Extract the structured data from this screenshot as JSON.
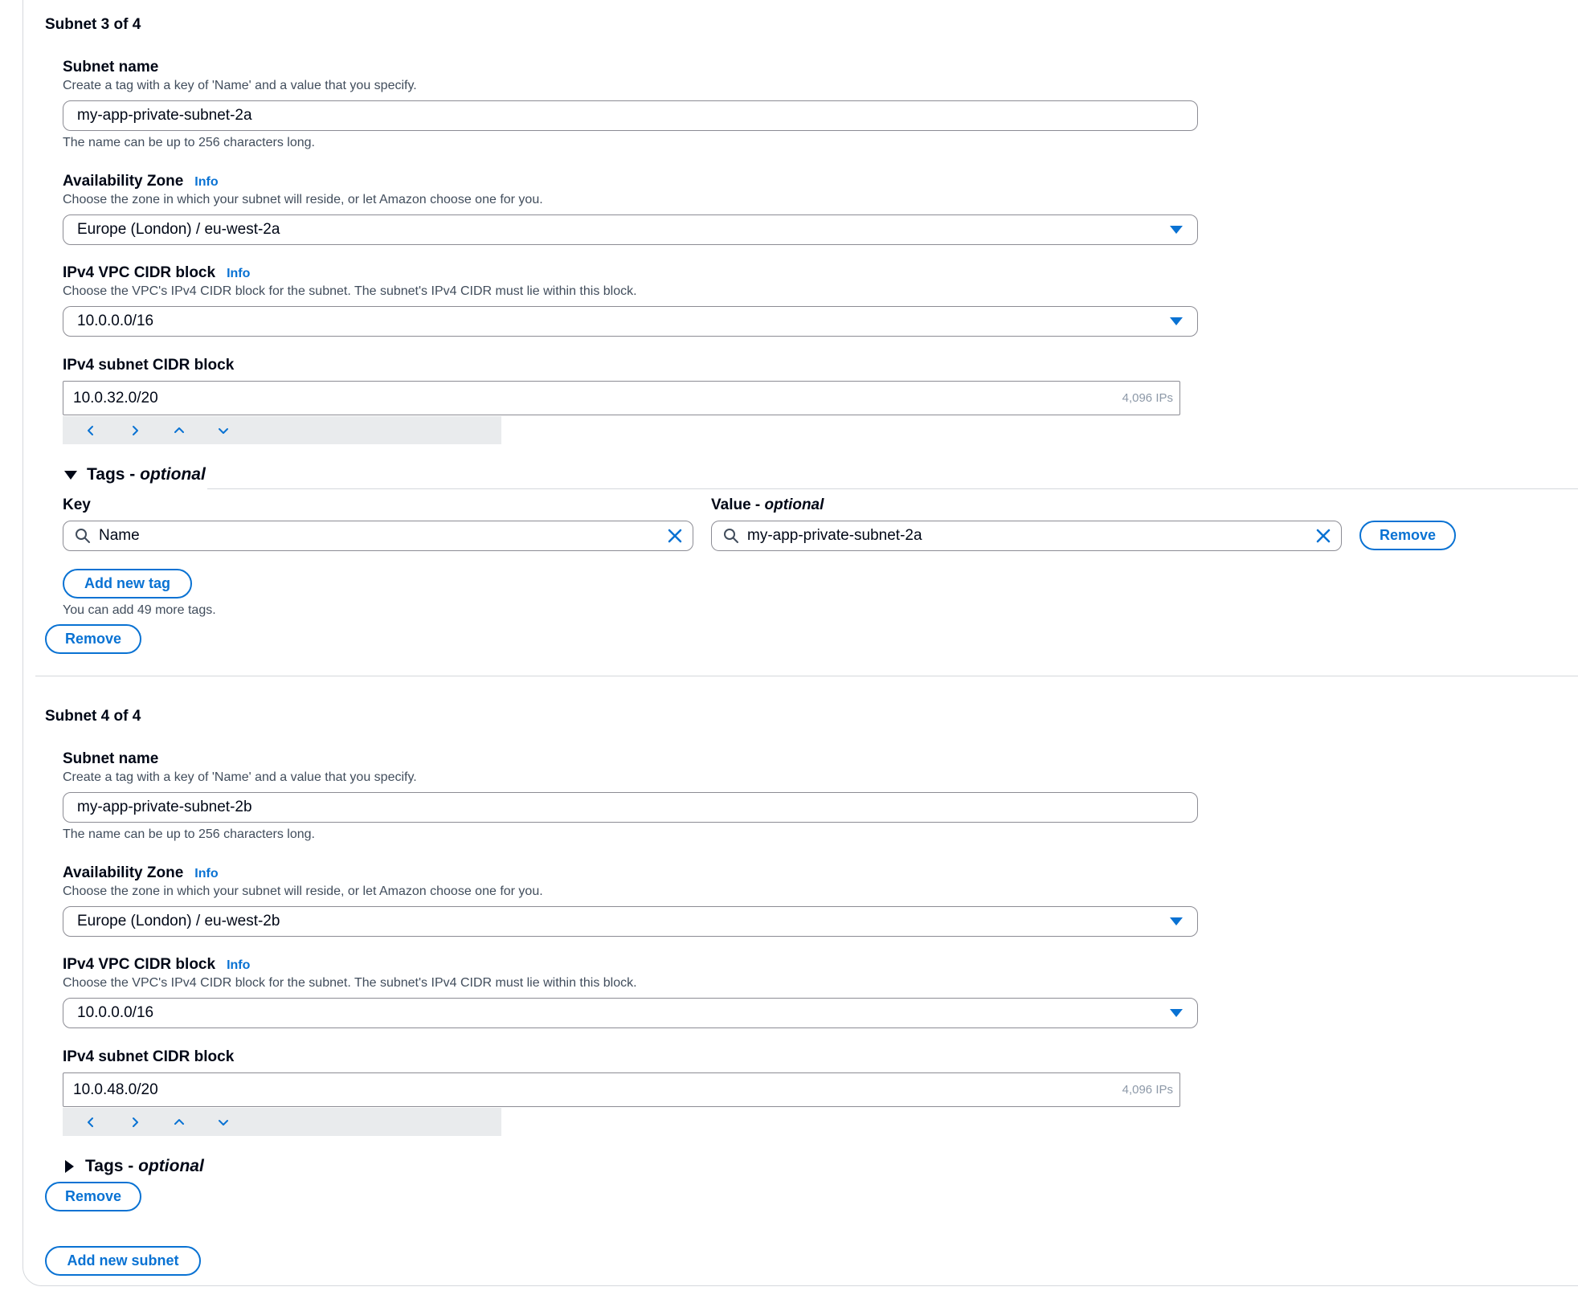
{
  "subnets": [
    {
      "title": "Subnet 3 of 4",
      "name_label": "Subnet name",
      "name_desc": "Create a tag with a key of 'Name' and a value that you specify.",
      "name_value": "my-app-private-subnet-2a",
      "name_hint": "The name can be up to 256 characters long.",
      "az_label": "Availability Zone",
      "az_info": "Info",
      "az_desc": "Choose the zone in which your subnet will reside, or let Amazon choose one for you.",
      "az_value": "Europe (London) / eu-west-2a",
      "vpc_cidr_label": "IPv4 VPC CIDR block",
      "vpc_cidr_info": "Info",
      "vpc_cidr_desc": "Choose the VPC's IPv4 CIDR block for the subnet. The subnet's IPv4 CIDR must lie within this block.",
      "vpc_cidr_value": "10.0.0.0/16",
      "subnet_cidr_label": "IPv4 subnet CIDR block",
      "subnet_cidr_value": "10.0.32.0/20",
      "subnet_cidr_ips": "4,096 IPs",
      "tags_label": "Tags - ",
      "tags_optional": "optional",
      "tags_expanded": true,
      "tag_key_header": "Key",
      "tag_value_header": "Value - ",
      "tag_value_optional": "optional",
      "tag_key": "Name",
      "tag_value": "my-app-private-subnet-2a",
      "tag_remove": "Remove",
      "add_tag": "Add new tag",
      "tags_hint": "You can add 49 more tags.",
      "remove": "Remove"
    },
    {
      "title": "Subnet 4 of 4",
      "name_label": "Subnet name",
      "name_desc": "Create a tag with a key of 'Name' and a value that you specify.",
      "name_value": "my-app-private-subnet-2b",
      "name_hint": "The name can be up to 256 characters long.",
      "az_label": "Availability Zone",
      "az_info": "Info",
      "az_desc": "Choose the zone in which your subnet will reside, or let Amazon choose one for you.",
      "az_value": "Europe (London) / eu-west-2b",
      "vpc_cidr_label": "IPv4 VPC CIDR block",
      "vpc_cidr_info": "Info",
      "vpc_cidr_desc": "Choose the VPC's IPv4 CIDR block for the subnet. The subnet's IPv4 CIDR must lie within this block.",
      "vpc_cidr_value": "10.0.0.0/16",
      "subnet_cidr_label": "IPv4 subnet CIDR block",
      "subnet_cidr_value": "10.0.48.0/20",
      "subnet_cidr_ips": "4,096 IPs",
      "tags_label": "Tags - ",
      "tags_optional": "optional",
      "tags_expanded": false,
      "remove": "Remove"
    }
  ],
  "add_subnet": "Add new subnet",
  "icons": {
    "stepper": [
      "chevron-left-icon",
      "chevron-right-icon",
      "chevron-up-icon",
      "chevron-down-icon"
    ],
    "search": "search-icon",
    "clear": "close-icon",
    "dropdown": "caret-down-icon"
  },
  "colors": {
    "accent": "#0972d3",
    "text": "#000716",
    "muted": "#414d5c",
    "border": "#8c8c94"
  }
}
